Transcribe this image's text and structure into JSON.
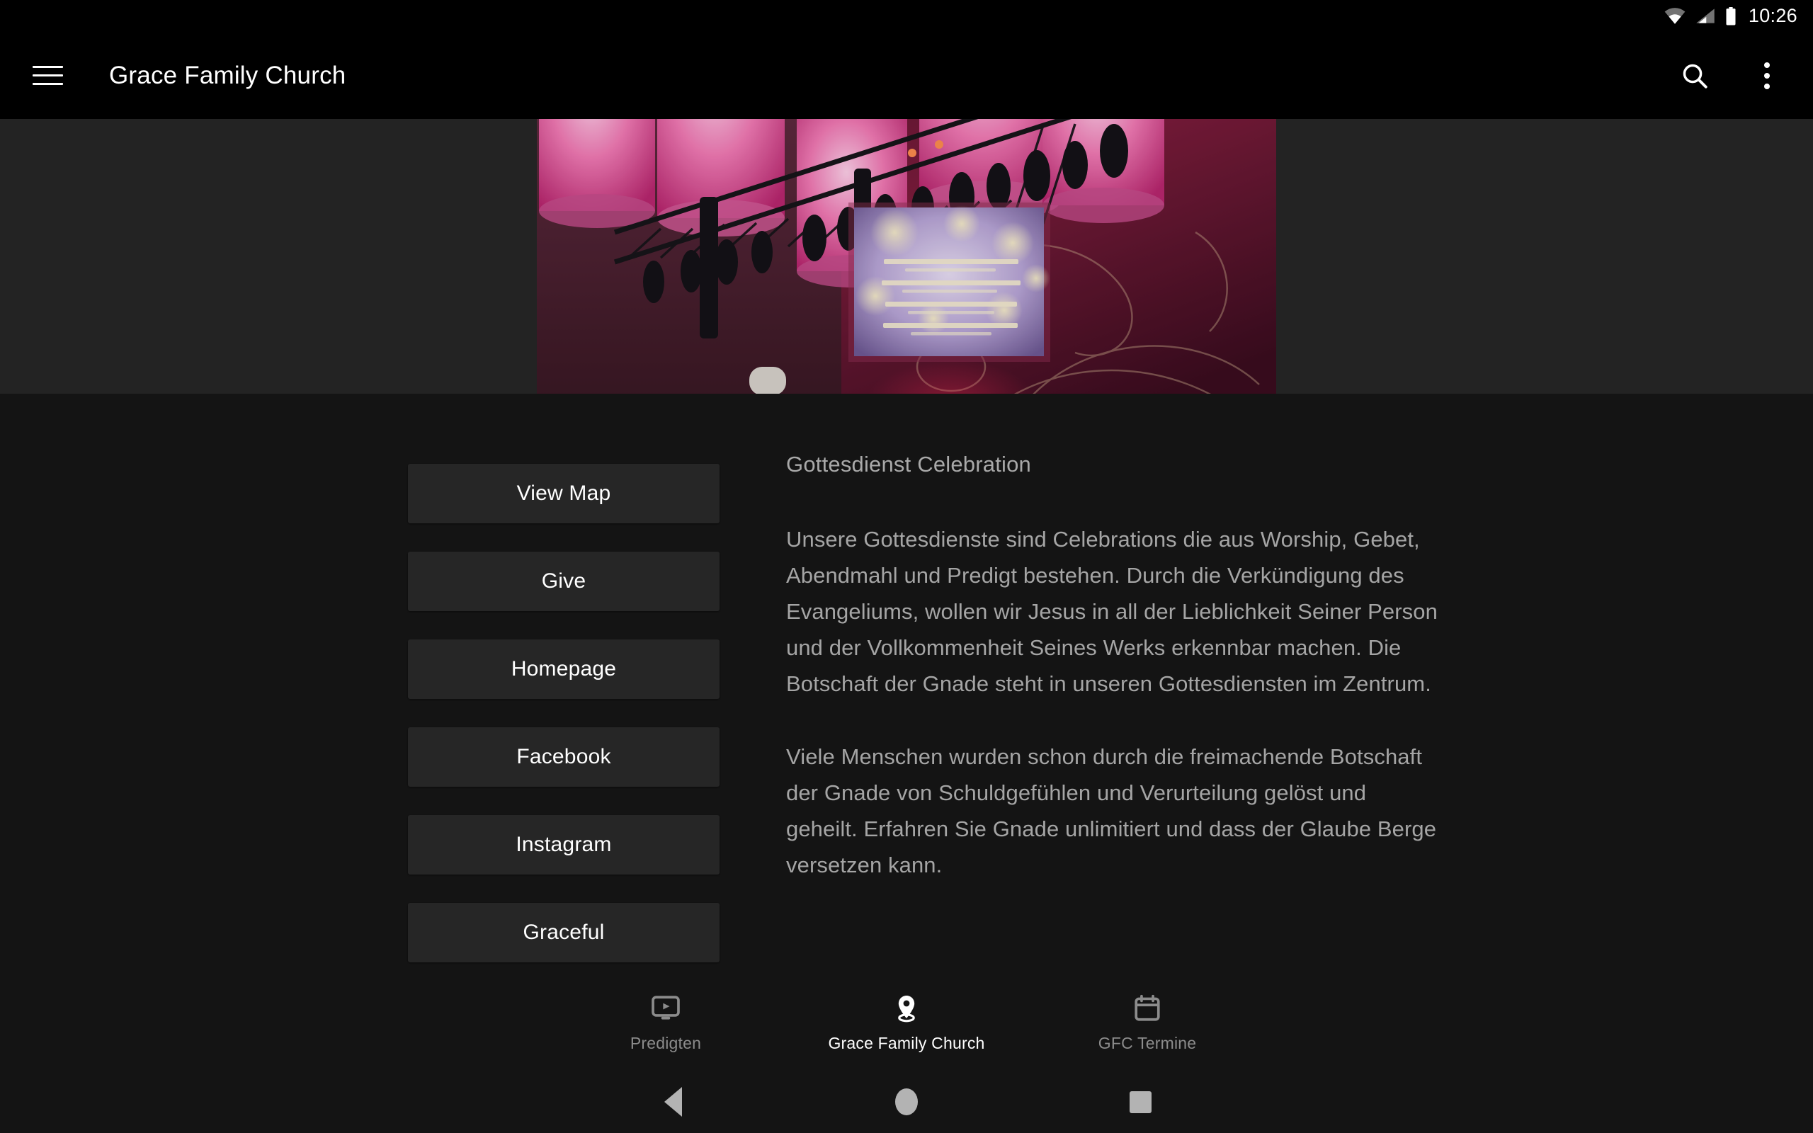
{
  "status_bar": {
    "time": "10:26",
    "icons": [
      "wifi-icon",
      "cellular-signal-icon",
      "battery-icon"
    ]
  },
  "toolbar": {
    "menu_icon": "hamburger-menu-icon",
    "title": "Grace Family Church",
    "search_icon": "search-icon",
    "overflow_icon": "overflow-menu-icon"
  },
  "hero": {
    "alt": "church-worship-service-photo",
    "description": "Worship celebration hall with pink hanging lantern lights, lighting truss and projection screen above a crowd"
  },
  "buttons": [
    {
      "label": "View Map",
      "name": "view-map-button"
    },
    {
      "label": "Give",
      "name": "give-button"
    },
    {
      "label": "Homepage",
      "name": "homepage-button"
    },
    {
      "label": "Facebook",
      "name": "facebook-button"
    },
    {
      "label": "Instagram",
      "name": "instagram-button"
    },
    {
      "label": "Graceful",
      "name": "graceful-button"
    }
  ],
  "article": {
    "title": "Gottesdienst Celebration",
    "paragraph_1": "Unsere Gottesdienste sind Celebrations die aus Worship, Gebet, Abendmahl und Predigt bestehen. Durch die Verkündigung des Evangeliums, wollen wir Jesus in all der Lieblichkeit Seiner Person und der Vollkommenheit Seines Werks erkennbar machen. Die Botschaft der Gnade steht in unseren Gottesdiensten im Zentrum.",
    "paragraph_2": "Viele Menschen wurden schon durch die freimachende Botschaft der Gnade von Schuldgefühlen und Verurteilung gelöst und geheilt. Erfahren Sie Gnade unlimitiert und dass der Glaube Berge versetzen kann."
  },
  "tabs": [
    {
      "label": "Predigten",
      "icon": "ondemand-video-icon",
      "active": false
    },
    {
      "label": "Grace Family Church",
      "icon": "location-pin-icon",
      "active": true
    },
    {
      "label": "GFC Termine",
      "icon": "calendar-icon",
      "active": false
    }
  ],
  "system_nav": {
    "back": "back-button",
    "home": "home-button",
    "recents": "recents-button"
  },
  "colors": {
    "window_background": "#141414",
    "hero_band_background": "#232323",
    "button_background": "#262626",
    "toolbar_background": "#000000",
    "body_text": "#a5a5a5",
    "accent_text": "#ffffff"
  }
}
